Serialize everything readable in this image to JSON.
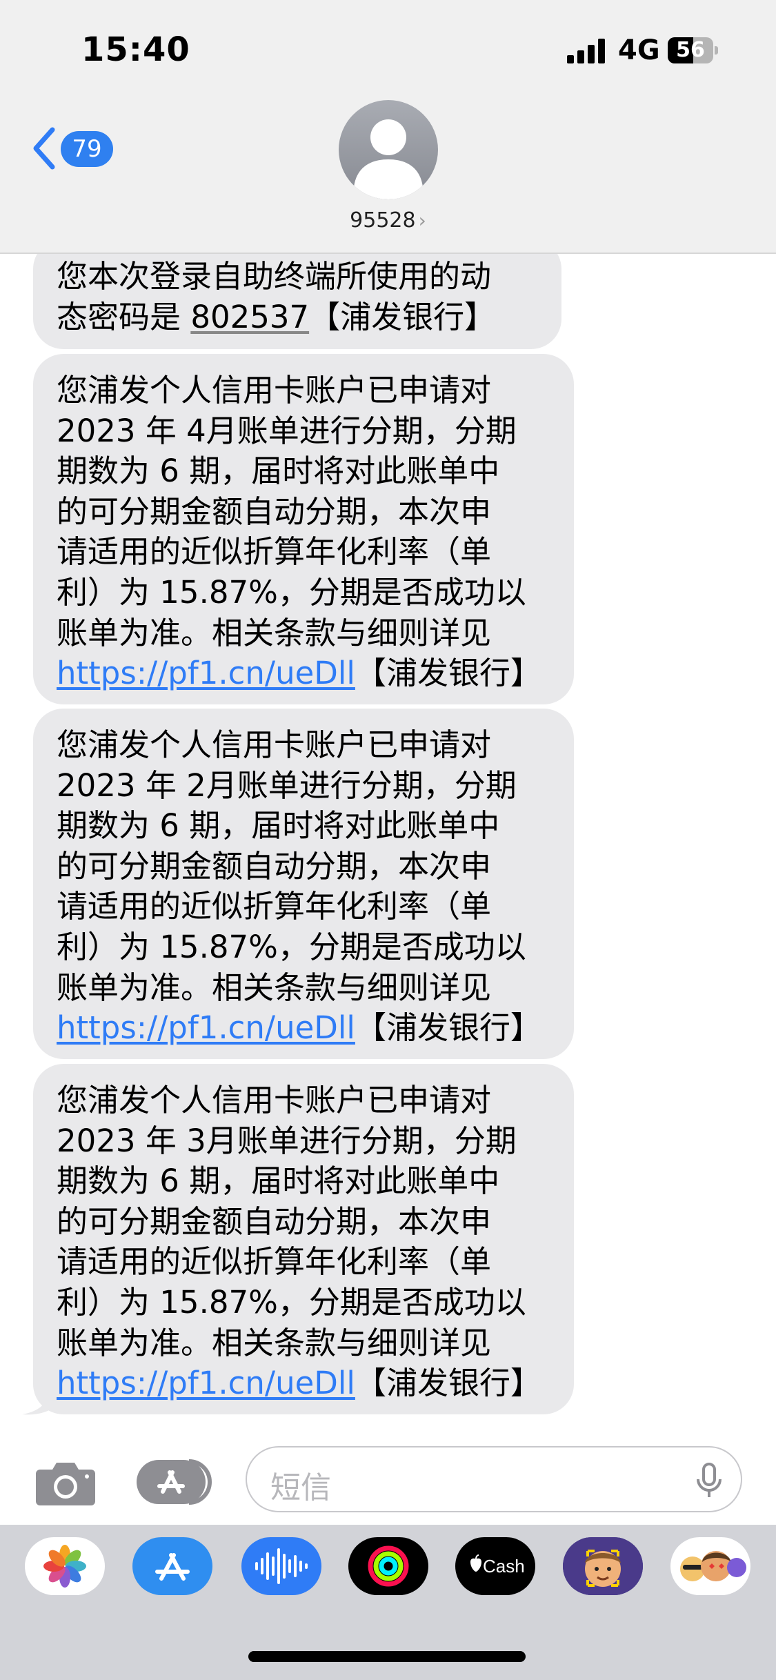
{
  "status_bar": {
    "time": "15:40",
    "network": "4G",
    "battery_level": "56",
    "battery_fraction": 0.56
  },
  "header": {
    "back_badge": "79",
    "contact_name": "95528",
    "contact_chevron": "›"
  },
  "messages": [
    {
      "lines": [
        "您本次登录自助终端所使用的动",
        "态密码是 "
      ],
      "code": "802537",
      "suffix": "【浦发银行】"
    },
    {
      "lines": [
        "您浦发个人信用卡账户已申请对",
        "2023 年 4月账单进行分期，分期",
        "期数为 6 期，届时将对此账单中",
        "的可分期金额自动分期，本次申",
        "请适用的近似折算年化利率（单",
        "利）为 15.87%，分期是否成功以",
        "账单为准。相关条款与细则详见"
      ],
      "link": "https://pf1.cn/ueDll",
      "suffix": "【浦发银行】"
    },
    {
      "lines": [
        "您浦发个人信用卡账户已申请对",
        "2023 年 2月账单进行分期，分期",
        "期数为 6 期，届时将对此账单中",
        "的可分期金额自动分期，本次申",
        "请适用的近似折算年化利率（单",
        "利）为 15.87%，分期是否成功以",
        "账单为准。相关条款与细则详见"
      ],
      "link": "https://pf1.cn/ueDll",
      "suffix": "【浦发银行】"
    },
    {
      "lines": [
        "您浦发个人信用卡账户已申请对",
        "2023 年 3月账单进行分期，分期",
        "期数为 6 期，届时将对此账单中",
        "的可分期金额自动分期，本次申",
        "请适用的近似折算年化利率（单",
        "利）为 15.87%，分期是否成功以",
        "账单为准。相关条款与细则详见"
      ],
      "link": "https://pf1.cn/ueDll",
      "suffix": "【浦发银行】"
    }
  ],
  "input": {
    "placeholder": "短信"
  },
  "apps": [
    {
      "name": "photos",
      "icon": "photos-icon"
    },
    {
      "name": "app-store",
      "icon": "app-store-icon"
    },
    {
      "name": "audio",
      "icon": "audio-waveform-icon"
    },
    {
      "name": "fitness",
      "icon": "activity-rings-icon"
    },
    {
      "name": "apple-cash",
      "icon": "apple-cash-icon",
      "label": "Cash"
    },
    {
      "name": "memoji",
      "icon": "memoji-icon"
    },
    {
      "name": "memoji-stickers",
      "icon": "memoji-stickers-icon"
    }
  ],
  "colors": {
    "accent_blue": "#2f7cf6",
    "bubble_gray": "#e9e9eb",
    "header_bg": "#f0f0f0",
    "drawer_bg": "#d2d3d8"
  }
}
